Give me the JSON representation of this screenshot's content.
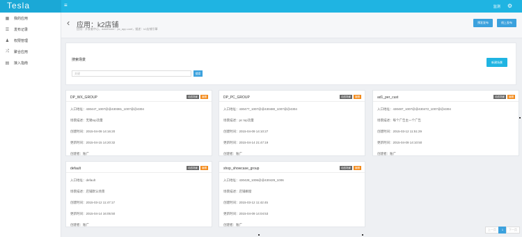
{
  "header": {
    "brand": "Tesla",
    "menu_icon": "hamburger-icon",
    "nav_label": "监测",
    "settings_icon": "gear-icon"
  },
  "sidebar": {
    "items": [
      {
        "label": "我的应用",
        "icon": "grid-icon"
      },
      {
        "label": "发布记录",
        "icon": "list-icon"
      },
      {
        "label": "权限管理",
        "icon": "user-icon"
      },
      {
        "label": "聚合应用",
        "icon": "shuffle-icon"
      },
      {
        "label": "接入指南",
        "icon": "doc-icon"
      }
    ]
  },
  "page": {
    "title": "应用：k2店铺",
    "breadcrumb": "应用：开发者中心，dataHome：pc_app.conf，描述：k2店铺引擎",
    "btn_prerelease": "预发发布",
    "btn_release": "线上发布"
  },
  "search": {
    "title": "搜索场景",
    "placeholder": "关键",
    "button": "搜索",
    "new_button": "新建场景"
  },
  "card_labels": {
    "entry": "入口地址：",
    "desc": "场景描述：",
    "created": "创建时间：",
    "updated": "更新时间：",
    "creator": "创建者："
  },
  "cards": [
    {
      "name": "DP_WX_GROUP",
      "tag1": "动态场景",
      "tag2": "编辑",
      "entry": "430447_1007@@430381_1007@@4304",
      "desc": "无锡top流量",
      "created": "2015-04-09 14:16:20",
      "updated": "2015-04-15 14:20:32",
      "creator": "账广"
    },
    {
      "name": "DP_PC_GROUP",
      "tag1": "动态场景",
      "tag2": "编辑",
      "entry": "430477_1007@@430480_1007@@4304",
      "desc": "pc top流量",
      "created": "2015-04-09 14:10:27",
      "updated": "2015-04-14 21:47:19",
      "creator": "账广"
    },
    {
      "name": "ad1_per_cust",
      "tag1": "动态场景",
      "tag2": "编辑",
      "entry": "430487_1007@@430472_1007@@4304",
      "desc": "每个广告主一个广告",
      "created": "2015-03-12 11:51:29",
      "updated": "2015-04-09 14:10:50",
      "creator": "账广"
    },
    {
      "name": "default",
      "tag1": "动态场景",
      "tag2": "编辑",
      "entry": "default",
      "desc": "店铺默认场景",
      "created": "2015-03-12 11:47:17",
      "updated": "2015-04-14 16:05:50",
      "creator": "账广"
    },
    {
      "name": "shop_showcase_group",
      "tag1": "动态场景",
      "tag2": "编辑",
      "entry": "430428_1006@@430429_1006",
      "desc": "店铺橱窗",
      "created": "2015-03-12 11:42:45",
      "updated": "2015-04-09 14:04:53",
      "creator": "账广"
    }
  ],
  "pagination": {
    "prev": "上一页",
    "current": "1",
    "next": "下一页"
  }
}
